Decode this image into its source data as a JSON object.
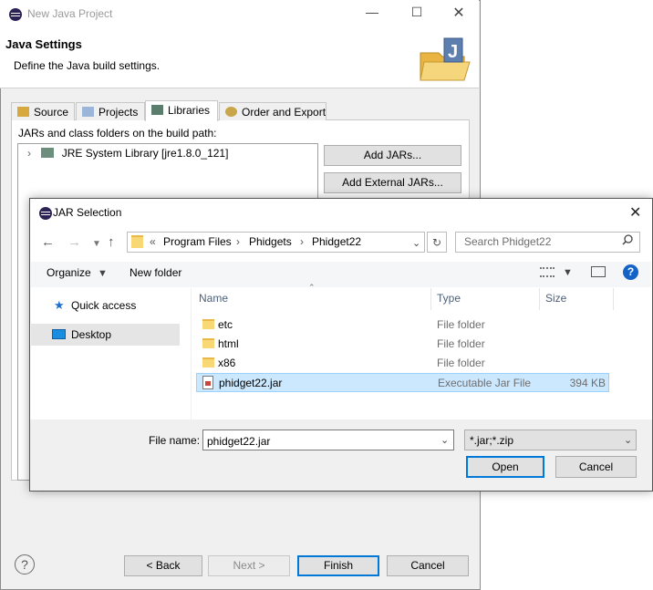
{
  "back": {
    "title": "New Java Project",
    "header_title": "Java Settings",
    "header_desc": "Define the Java build settings.",
    "tabs": [
      {
        "label": "Source",
        "icon": "source-icon"
      },
      {
        "label": "Projects",
        "icon": "projects-icon"
      },
      {
        "label": "Libraries",
        "icon": "libraries-icon",
        "active": true
      },
      {
        "label": "Order and Export",
        "icon": "order-icon"
      }
    ],
    "build_path_label": "JARs and class folders on the build path:",
    "library_item": "JRE System Library [jre1.8.0_121]",
    "buttons": {
      "add_jars": "Add JARs...",
      "add_external_jars": "Add External JARs..."
    },
    "footer": {
      "help": "?",
      "back": "< Back",
      "next": "Next >",
      "finish": "Finish",
      "cancel": "Cancel"
    }
  },
  "dialog": {
    "title": "JAR Selection",
    "breadcrumb": {
      "overflow": "«",
      "items": [
        "Program Files",
        "Phidgets",
        "Phidget22"
      ]
    },
    "search_placeholder": "Search Phidget22",
    "toolbar": {
      "organize": "Organize",
      "new_folder": "New folder"
    },
    "nav_pane": {
      "quick_access": "Quick access",
      "desktop": "Desktop"
    },
    "columns": {
      "name": "Name",
      "type": "Type",
      "size": "Size"
    },
    "files": [
      {
        "name": "etc",
        "type": "File folder",
        "size": "",
        "kind": "folder"
      },
      {
        "name": "html",
        "type": "File folder",
        "size": "",
        "kind": "folder"
      },
      {
        "name": "x86",
        "type": "File folder",
        "size": "",
        "kind": "folder"
      },
      {
        "name": "phidget22.jar",
        "type": "Executable Jar File",
        "size": "394 KB",
        "kind": "jar",
        "selected": true
      }
    ],
    "file_name_label": "File name:",
    "file_name_value": "phidget22.jar",
    "file_type": "*.jar;*.zip",
    "buttons": {
      "open": "Open",
      "cancel": "Cancel"
    }
  },
  "colors": {
    "selection_bg": "#cce8ff",
    "selection_border": "#99d1ff",
    "accent": "#0078d7"
  }
}
